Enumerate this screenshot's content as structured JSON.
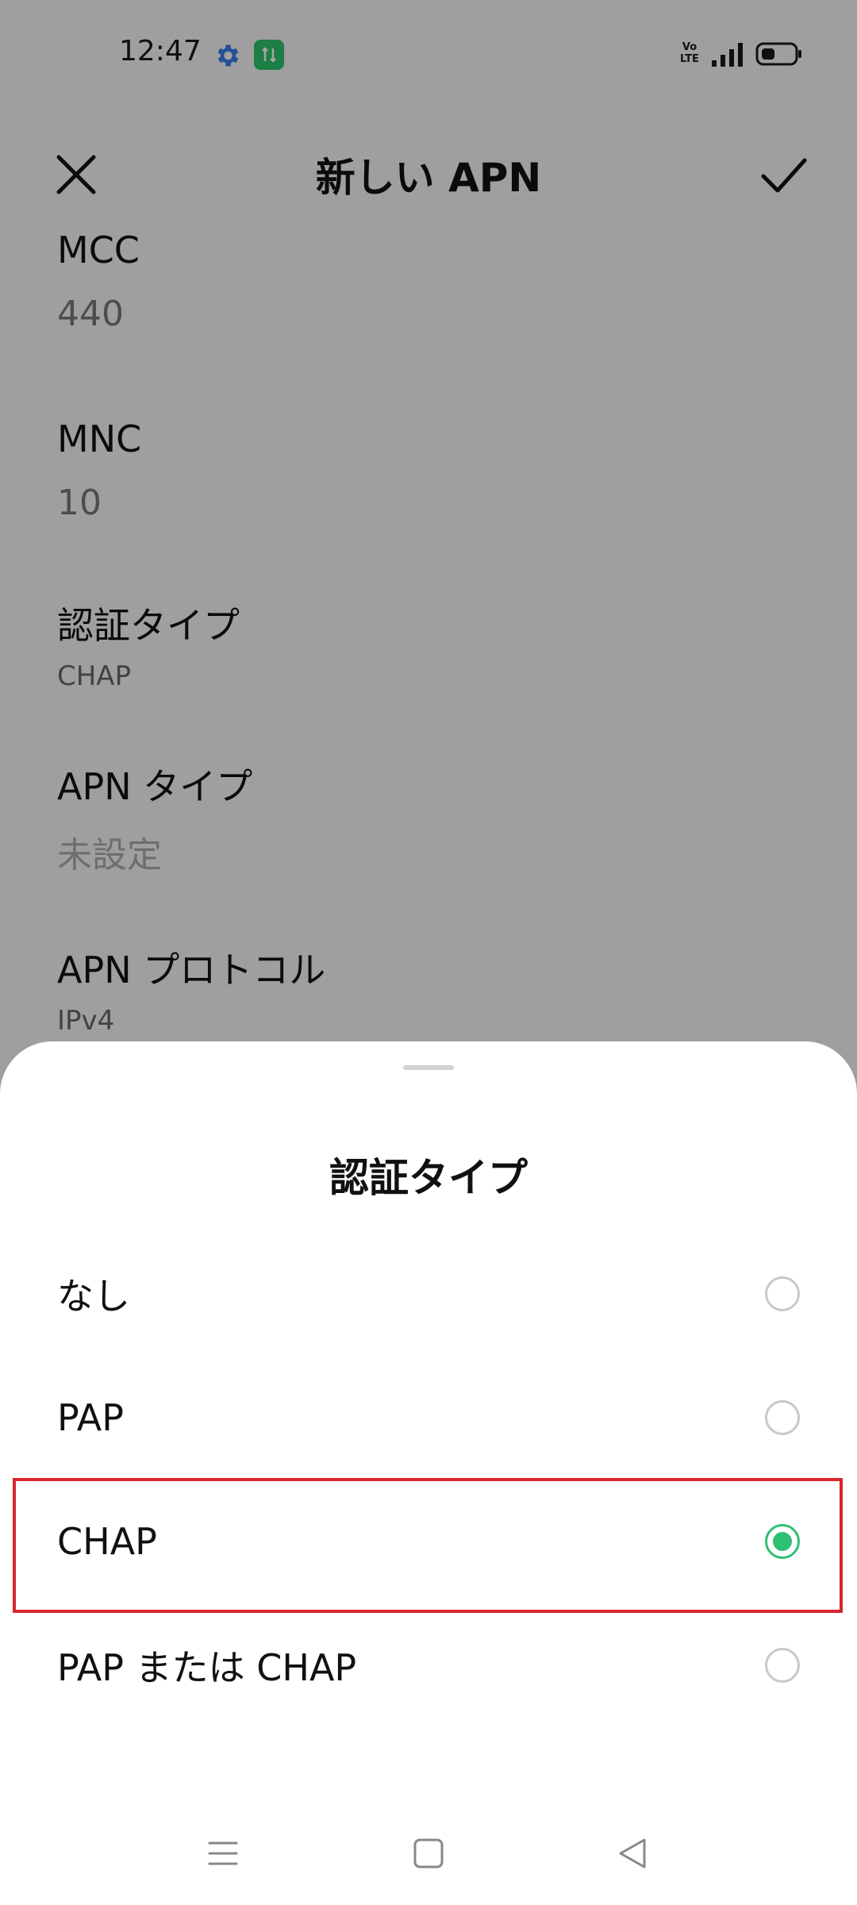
{
  "status_bar": {
    "time": "12:47",
    "volte_label": "Vo\nLTE",
    "icons": [
      "gear-icon",
      "app-notification-icon",
      "volte-icon",
      "signal-icon",
      "battery-icon"
    ]
  },
  "app_bar": {
    "title": "新しい APN",
    "close_icon": "close-icon",
    "confirm_icon": "check-icon"
  },
  "fields": {
    "mcc": {
      "label": "MCC",
      "value": "440"
    },
    "mnc": {
      "label": "MNC",
      "value": "10"
    },
    "auth_type": {
      "label": "認証タイプ",
      "value": "CHAP"
    },
    "apn_type": {
      "label": "APN タイプ",
      "value": "未設定"
    },
    "apn_protocol": {
      "label": "APN プロトコル",
      "value": "IPv4"
    }
  },
  "sheet": {
    "title": "認証タイプ",
    "options": [
      {
        "label": "なし",
        "selected": false
      },
      {
        "label": "PAP",
        "selected": false
      },
      {
        "label": "CHAP",
        "selected": true
      },
      {
        "label": "PAP または CHAP",
        "selected": false
      }
    ]
  },
  "nav_bar": {
    "icons": [
      "menu-icon",
      "home-icon",
      "back-icon"
    ]
  },
  "colors": {
    "accent_green": "#2fbf73",
    "highlight_red": "#d9262f",
    "app_badge_green": "#2dc36a",
    "gear_blue": "#3b7be8"
  }
}
